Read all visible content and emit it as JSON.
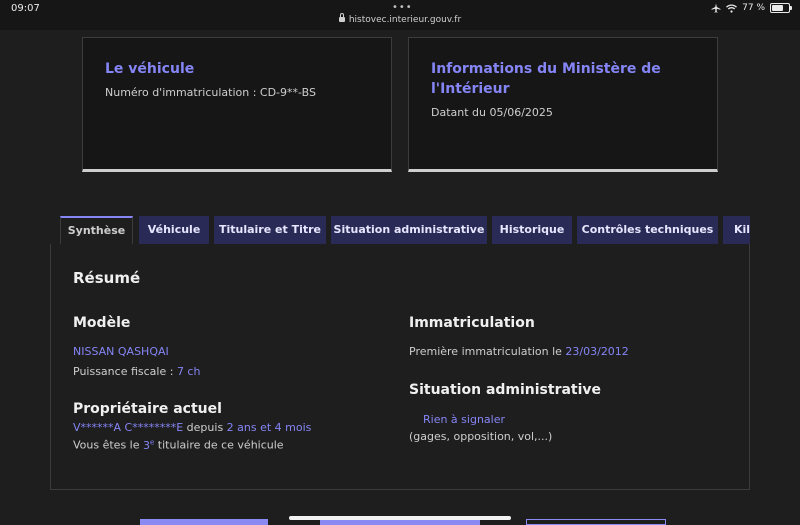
{
  "status_bar": {
    "time": "09:07",
    "dots": "•••",
    "url": "histovec.interieur.gouv.fr",
    "battery": "77 %",
    "battery_level": 0.77
  },
  "cards": [
    {
      "title": "Le véhicule",
      "text": "Numéro d'immatriculation : CD-9**-BS"
    },
    {
      "title": "Informations du Ministère de l'Intérieur",
      "text": "Datant du 05/06/2025"
    }
  ],
  "tabs": [
    {
      "label": "Synthèse",
      "active": true
    },
    {
      "label": "Véhicule"
    },
    {
      "label": "Titulaire et Titre"
    },
    {
      "label": "Situation administrative"
    },
    {
      "label": "Historique"
    },
    {
      "label": "Contrôles techniques"
    },
    {
      "label": "Kilométrage"
    }
  ],
  "summary": {
    "heading": "Résumé",
    "model": {
      "heading": "Modèle",
      "name": "NISSAN QASHQAI",
      "power_label": "Puissance fiscale : ",
      "power_value": "7 ch"
    },
    "owner": {
      "heading": "Propriétaire actuel",
      "name": "V******A C********E",
      "since_label": " depuis ",
      "since_value": "2 ans et 4 mois",
      "rank_prefix": "Vous êtes le ",
      "rank_number": "3",
      "rank_sup": "e",
      "rank_suffix": " titulaire de ce véhicule"
    },
    "registration": {
      "heading": "Immatriculation",
      "label": "Première immatriculation le ",
      "date": "23/03/2012"
    },
    "admin": {
      "heading": "Situation administrative",
      "status": "Rien à signaler",
      "note": "(gages, opposition, vol,...)"
    }
  },
  "colors": {
    "background": "#1e1e1e",
    "card_background": "#161616",
    "accent": "#8585f6",
    "tab_background": "#2a2a56",
    "text": "#cecece"
  }
}
